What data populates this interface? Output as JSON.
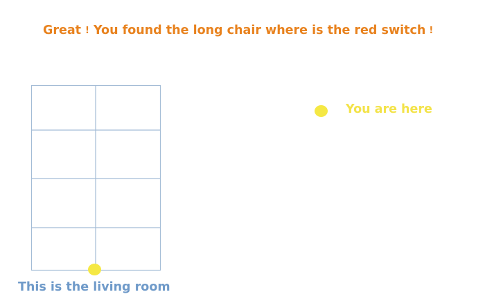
{
  "headline": {
    "lead": "Great",
    "mark_1": "!",
    "message": "You found the long chair where is the red switch",
    "mark_2": "!"
  },
  "marker": {
    "label": "You are here"
  },
  "room": {
    "label": "This is the living room",
    "columns": 2,
    "rows": 4
  },
  "colors": {
    "headline": "#e8821e",
    "marker": "#f5e844",
    "marker_text": "#f3e34a",
    "room_label": "#6f9ac9",
    "grid_line": "#a3bcd6"
  }
}
